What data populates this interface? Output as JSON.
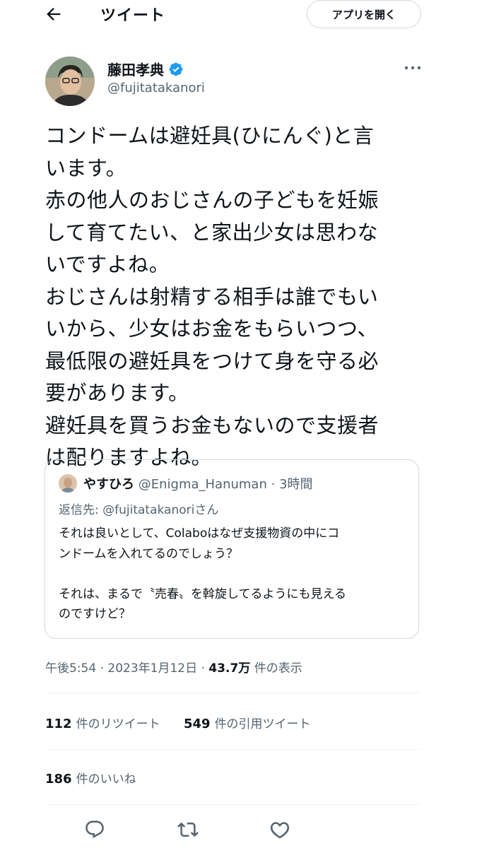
{
  "header": {
    "title": "ツイート",
    "open_app_label": "アプリを開く"
  },
  "author": {
    "name": "藤田孝典",
    "handle": "@fujitatakanori",
    "verified": true
  },
  "tweet": {
    "text": "コンドームは避妊具(ひにんぐ)と言\nいます。\n赤の他人のおじさんの子どもを妊娠\nして育てたい、と家出少女は思わな\nいですよね。\nおじさんは射精する相手は誰でもい\nいから、少女はお金をもらいつつ、\n最低限の避妊具をつけて身を守る必\n要があります。\n避妊具を買うお金もないので支援者\nは配りますよね。"
  },
  "quoted": {
    "name": "やすひろ",
    "handle": "@Enigma_Hanuman",
    "separator": "·",
    "time": "3時間",
    "reply_to": "返信先: @fujitatakanoriさん",
    "text": "それは良いとして、Colaboはなぜ支援物資の中にコ\nンドームを入れてるのでしょう？\n\nそれは、まるで〝売春〟を斡旋してるようにも見える\nのですけど？"
  },
  "meta": {
    "time": "午後5:54",
    "sep1": "·",
    "date": "2023年1月12日",
    "sep2": "·",
    "views_count": "43.7万",
    "views_label": "件の表示"
  },
  "stats": {
    "retweets_count": "112",
    "retweets_label": "件のリツイート",
    "quotes_count": "549",
    "quotes_label": "件の引用ツイート",
    "likes_count": "186",
    "likes_label": "件のいいね"
  },
  "colors": {
    "text": "#0f1419",
    "secondary": "#536471",
    "border": "#cfd9de",
    "verified": "#1d9bf0"
  },
  "icons": [
    "back-arrow-icon",
    "verified-badge-icon",
    "more-icon",
    "reply-icon",
    "retweet-icon",
    "like-icon"
  ]
}
